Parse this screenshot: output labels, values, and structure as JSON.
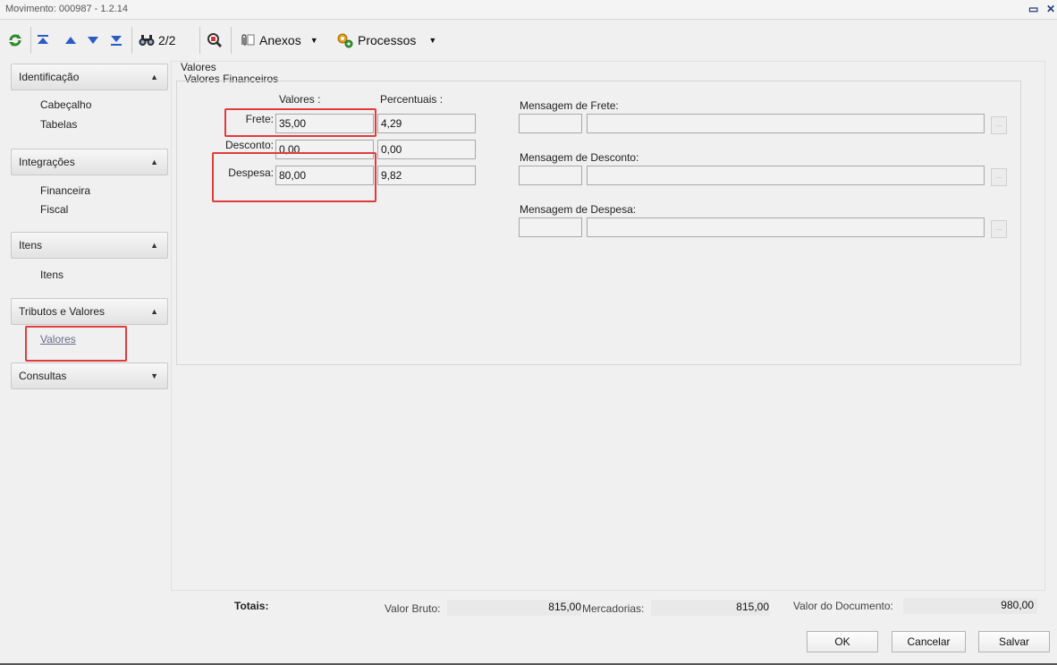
{
  "window": {
    "title": "Movimento: 000987 - 1.2.14",
    "restore_icon": "restore-icon",
    "close_icon": "close-icon"
  },
  "toolbar": {
    "record_position": "2/2",
    "attachments_label": "Anexos",
    "processes_label": "Processos"
  },
  "sidebar": {
    "groups": [
      {
        "title": "Identificação",
        "expanded": true,
        "items": [
          "Cabeçalho",
          "Tabelas"
        ]
      },
      {
        "title": "Integrações",
        "expanded": true,
        "items": [
          "Financeira",
          "Fiscal"
        ]
      },
      {
        "title": "Itens",
        "expanded": true,
        "items": [
          "Itens"
        ]
      },
      {
        "title": "Tributos e Valores",
        "expanded": true,
        "items": [
          "Valores"
        ]
      },
      {
        "title": "Consultas",
        "expanded": false,
        "items": []
      }
    ]
  },
  "main": {
    "section_title": "Valores",
    "group_title": "Valores Financeiros",
    "col_values": "Valores :",
    "col_percent": "Percentuais :",
    "rows": [
      {
        "label": "Frete:",
        "value": "35,00",
        "percent": "4,29"
      },
      {
        "label": "Desconto:",
        "value": "0,00",
        "percent": "0,00"
      },
      {
        "label": "Despesa:",
        "value": "80,00",
        "percent": "9,82"
      }
    ],
    "messages": [
      {
        "label": "Mensagem de Frete:",
        "code": "",
        "text": ""
      },
      {
        "label": "Mensagem de Desconto:",
        "code": "",
        "text": ""
      },
      {
        "label": "Mensagem de Despesa:",
        "code": "",
        "text": ""
      }
    ],
    "ellipsis": "..."
  },
  "footer": {
    "totals_label": "Totais:",
    "gross_label": "Valor Bruto:",
    "gross_value": "815,00",
    "goods_label": "Mercadorias:",
    "goods_value": "815,00",
    "doc_label": "Valor do Documento:",
    "doc_value": "980,00",
    "ok": "OK",
    "cancel": "Cancelar",
    "save": "Salvar"
  },
  "colors": {
    "highlight": "#e03c3c",
    "link": "#6a6a8a"
  }
}
